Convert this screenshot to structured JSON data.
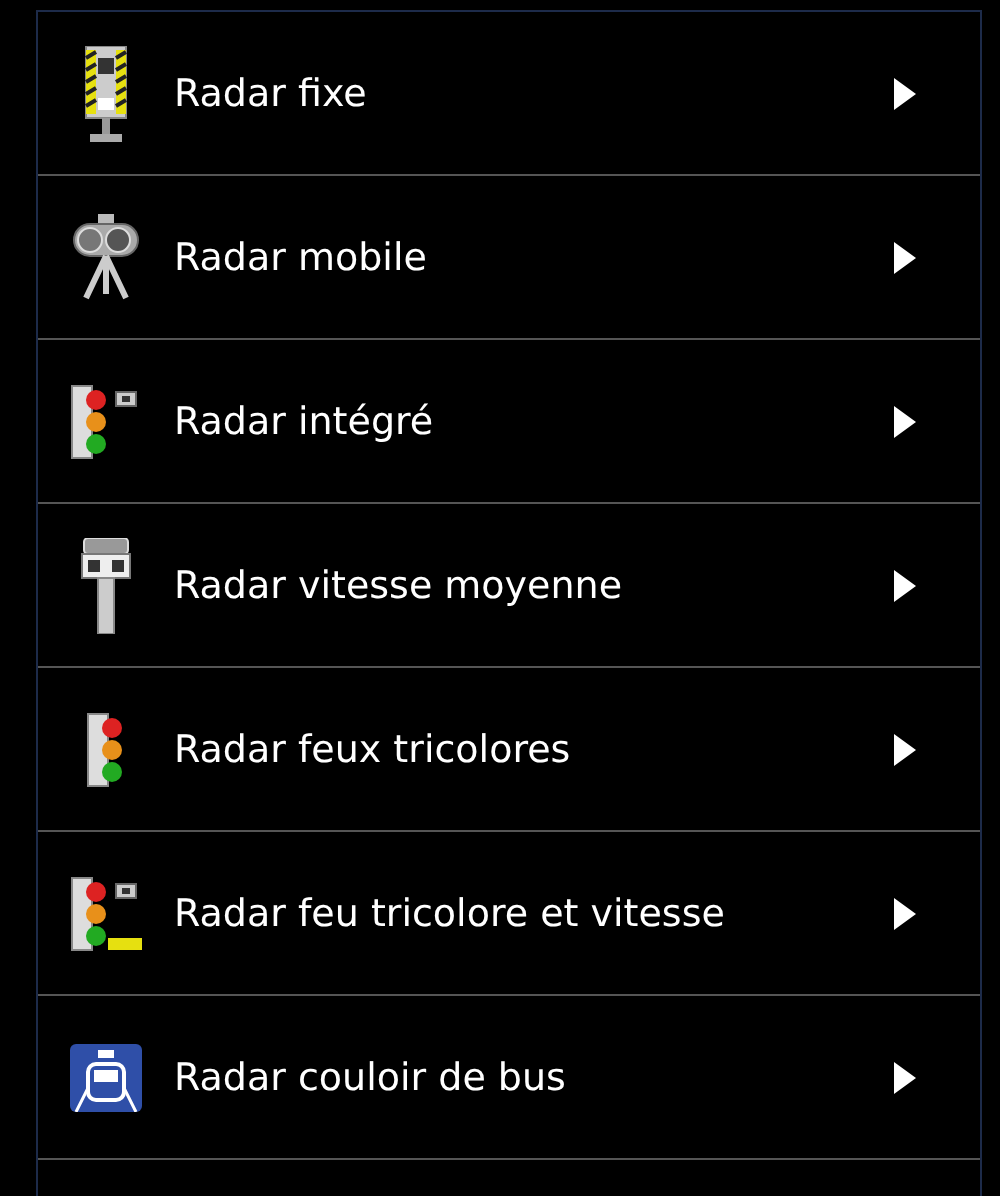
{
  "items": [
    {
      "label": "Radar fixe",
      "kind": "fixed"
    },
    {
      "label": "Radar mobile",
      "kind": "mobile"
    },
    {
      "label": "Radar intégré",
      "kind": "integrated"
    },
    {
      "label": "Radar vitesse moyenne",
      "kind": "average"
    },
    {
      "label": "Radar feux tricolores",
      "kind": "traffic-light"
    },
    {
      "label": "Radar feu tricolore et vitesse",
      "kind": "light-speed"
    },
    {
      "label": "Radar couloir de bus",
      "kind": "bus-lane"
    }
  ]
}
